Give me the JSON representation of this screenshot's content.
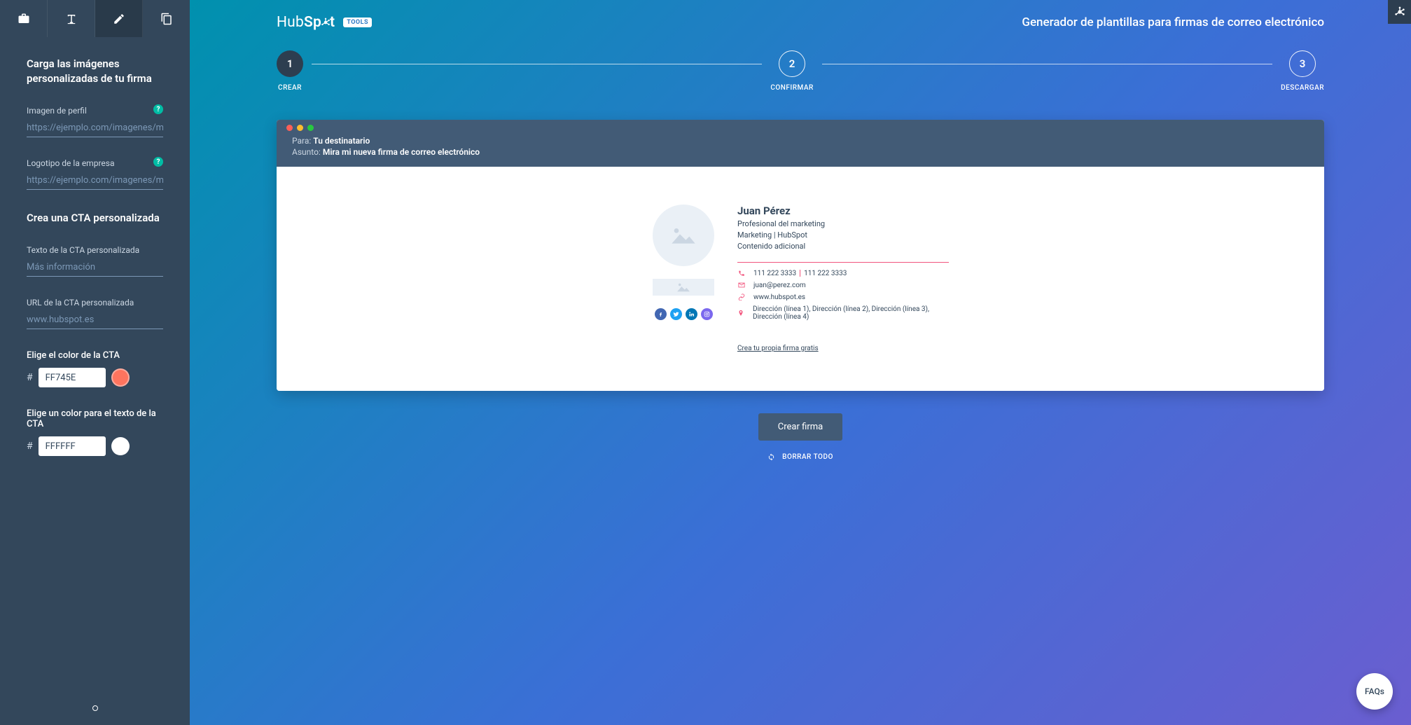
{
  "header": {
    "logo_text": "HubSpot",
    "tools_badge": "TOOLS",
    "title": "Generador de plantillas para firmas de correo electrónico"
  },
  "steps": [
    {
      "num": "1",
      "label": "CREAR",
      "active": true
    },
    {
      "num": "2",
      "label": "CONFIRMAR",
      "active": false
    },
    {
      "num": "3",
      "label": "DESCARGAR",
      "active": false
    }
  ],
  "sidebar": {
    "section1_title": "Carga las imágenes personalizadas de tu firma",
    "profile_image_label": "Imagen de perfil",
    "profile_image_placeholder": "https://ejemplo.com/imagenes/mifoto",
    "company_logo_label": "Logotipo de la empresa",
    "company_logo_placeholder": "https://ejemplo.com/imagenes/mifoto",
    "section2_title": "Crea una CTA personalizada",
    "cta_text_label": "Texto de la CTA personalizada",
    "cta_text_placeholder": "Más información",
    "cta_url_label": "URL de la CTA personalizada",
    "cta_url_placeholder": "www.hubspot.es",
    "cta_color_label": "Elige el color de la CTA",
    "cta_color_value": "FF745E",
    "cta_text_color_label": "Elige un color para el texto de la CTA",
    "cta_text_color_value": "FFFFFF",
    "help_glyph": "?"
  },
  "email": {
    "to_label": "Para:",
    "to_value": "Tu destinatario",
    "subject_label": "Asunto:",
    "subject_value": "Mira mi nueva firma de correo electrónico"
  },
  "signature": {
    "name": "Juan Pérez",
    "job_title": "Profesional del marketing",
    "dept_company": "Marketing | HubSpot",
    "extra": "Contenido adicional",
    "phone1": "111 222 3333",
    "phone2": "111 222 3333",
    "email": "juan@perez.com",
    "website": "www.hubspot.es",
    "address": "Dirección (línea 1), Dirección (línea 2), Dirección (línea 3), Dirección (línea 4)",
    "create_link": "Crea tu propia firma gratis",
    "social_colors": {
      "fb": "#4267B2",
      "tw": "#1DA1F2",
      "li": "#0077B5",
      "ig": "#7b68ee"
    }
  },
  "actions": {
    "create_button": "Crear firma",
    "clear_all": "BORRAR TODO"
  },
  "faqs": "FAQs",
  "colors": {
    "cta_swatch": "#FF745E",
    "cta_text_swatch": "#FFFFFF",
    "chrome_red": "#ff5f57",
    "chrome_yellow": "#febc2e",
    "chrome_green": "#28c840"
  }
}
